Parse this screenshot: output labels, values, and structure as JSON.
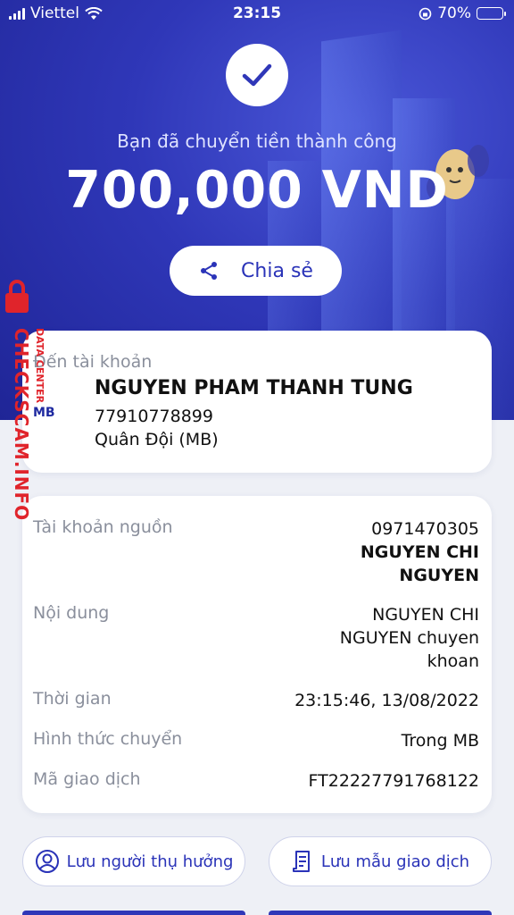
{
  "status_bar": {
    "carrier": "Viettel",
    "time": "23:15",
    "battery": "70%"
  },
  "hero": {
    "success_message": "Bạn đã chuyển tiền thành công",
    "amount": "700,000 VND",
    "share_label": "Chia sẻ"
  },
  "recipient": {
    "label": "Đến tài khoản",
    "bank_logo": "MB",
    "name": "NGUYEN PHAM THANH TUNG",
    "account_number": "77910778899",
    "bank": "Quân Đội (MB)"
  },
  "details": {
    "source_label": "Tài khoản nguồn",
    "source_account": "0971470305",
    "source_name_line1": "NGUYEN CHI",
    "source_name_line2": "NGUYEN",
    "content_label": "Nội dung",
    "content_line1": "NGUYEN CHI",
    "content_line2": "NGUYEN chuyen",
    "content_line3": "khoan",
    "time_label": "Thời gian",
    "time_value": "23:15:46, 13/08/2022",
    "method_label": "Hình thức chuyển",
    "method_value": "Trong MB",
    "txn_label": "Mã giao dịch",
    "txn_value": "FT22227791768122"
  },
  "actions": {
    "save_beneficiary": "Lưu người thụ hưởng",
    "save_template": "Lưu mẫu giao dịch"
  },
  "watermark": {
    "main": "CHECKSCAM.INFO",
    "sub": "DATA CENTER"
  },
  "colors": {
    "brand_blue": "#2f37b8",
    "accent_yellow": "#f5c51c",
    "watermark_red": "#e0242b"
  }
}
